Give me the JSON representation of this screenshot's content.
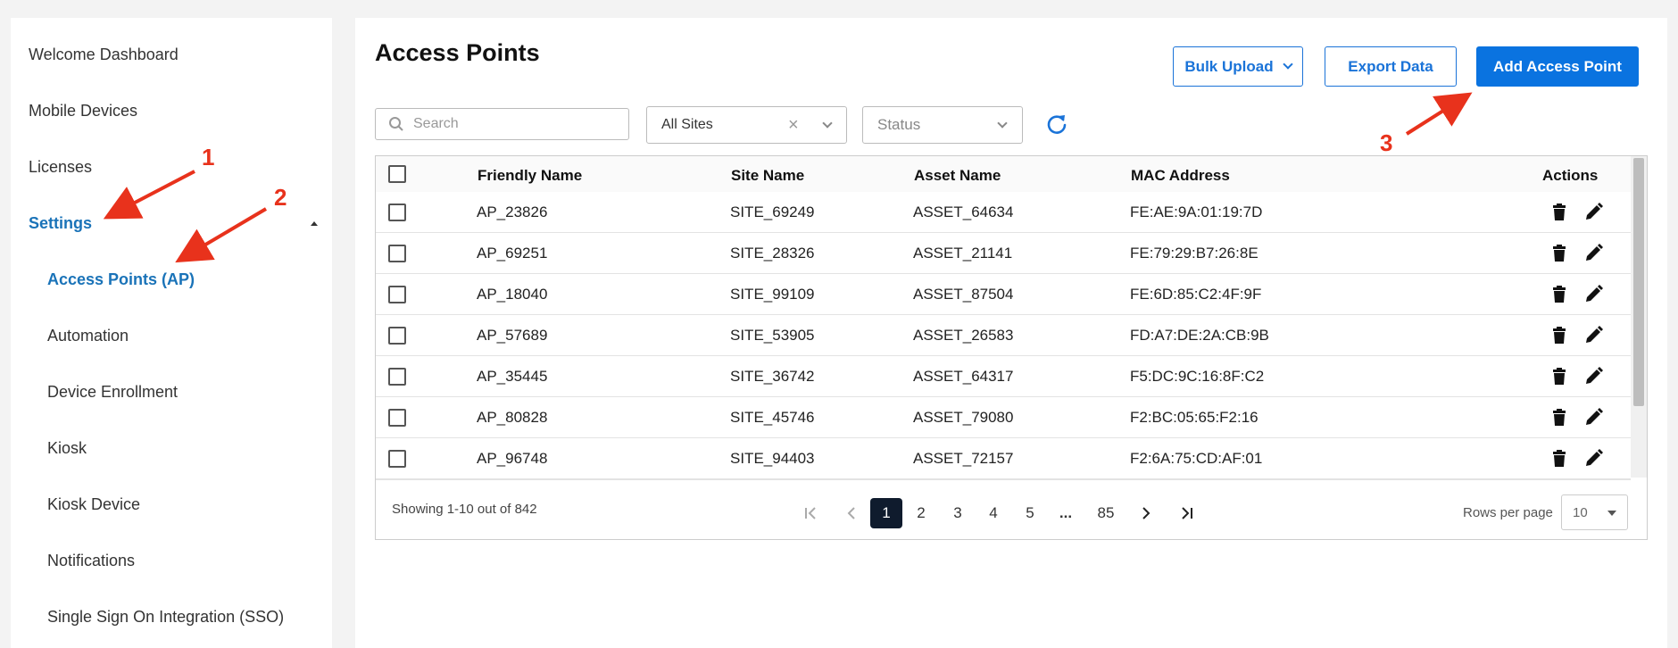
{
  "sidebar": {
    "items": [
      {
        "label": "Welcome Dashboard"
      },
      {
        "label": "Mobile Devices"
      },
      {
        "label": "Licenses"
      },
      {
        "label": "Settings"
      },
      {
        "label": "Access Points (AP)"
      },
      {
        "label": "Automation"
      },
      {
        "label": "Device Enrollment"
      },
      {
        "label": "Kiosk"
      },
      {
        "label": "Kiosk Device"
      },
      {
        "label": "Notifications"
      },
      {
        "label": "Single Sign On Integration (SSO)"
      }
    ]
  },
  "page": {
    "title": "Access Points",
    "bulk_upload_label": "Bulk Upload",
    "export_label": "Export Data",
    "add_label": "Add Access Point"
  },
  "filters": {
    "search_placeholder": "Search",
    "site_value": "All Sites",
    "status_placeholder": "Status"
  },
  "table": {
    "columns": [
      "Friendly Name",
      "Site Name",
      "Asset Name",
      "MAC Address",
      "Actions"
    ],
    "rows": [
      {
        "friendly": "AP_23826",
        "site": "SITE_69249",
        "asset": "ASSET_64634",
        "mac": "FE:AE:9A:01:19:7D"
      },
      {
        "friendly": "AP_69251",
        "site": "SITE_28326",
        "asset": "ASSET_21141",
        "mac": "FE:79:29:B7:26:8E"
      },
      {
        "friendly": "AP_18040",
        "site": "SITE_99109",
        "asset": "ASSET_87504",
        "mac": "FE:6D:85:C2:4F:9F"
      },
      {
        "friendly": "AP_57689",
        "site": "SITE_53905",
        "asset": "ASSET_26583",
        "mac": "FD:A7:DE:2A:CB:9B"
      },
      {
        "friendly": "AP_35445",
        "site": "SITE_36742",
        "asset": "ASSET_64317",
        "mac": "F5:DC:9C:16:8F:C2"
      },
      {
        "friendly": "AP_80828",
        "site": "SITE_45746",
        "asset": "ASSET_79080",
        "mac": "F2:BC:05:65:F2:16"
      },
      {
        "friendly": "AP_96748",
        "site": "SITE_94403",
        "asset": "ASSET_72157",
        "mac": "F2:6A:75:CD:AF:01"
      }
    ]
  },
  "footer": {
    "showing": "Showing 1-10 out of 842",
    "pages": [
      "1",
      "2",
      "3",
      "4",
      "5",
      "...",
      "85"
    ],
    "current_page": "1",
    "rows_label": "Rows per page",
    "rows_value": "10"
  },
  "annotations": [
    "1",
    "2",
    "3"
  ],
  "colors": {
    "accent": "#1a73b8",
    "primary_button": "#0a73e0",
    "annotation": "#e8321c",
    "active_page": "#0f1b2d"
  }
}
